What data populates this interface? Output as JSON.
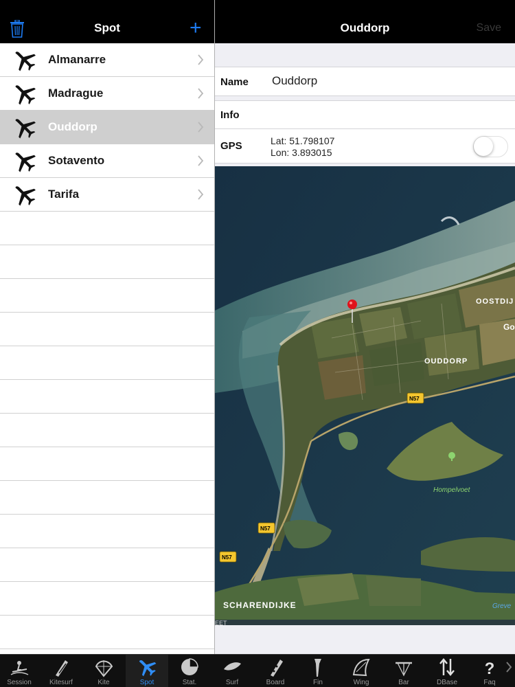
{
  "left_panel": {
    "title": "Spot",
    "spots": [
      {
        "label": "Almanarre",
        "selected": false
      },
      {
        "label": "Madrague",
        "selected": false
      },
      {
        "label": "Ouddorp",
        "selected": true
      },
      {
        "label": "Sotavento",
        "selected": false
      },
      {
        "label": "Tarifa",
        "selected": false
      }
    ]
  },
  "detail": {
    "title": "Ouddorp",
    "save_label": "Save",
    "name_label": "Name",
    "name_value": "Ouddorp",
    "info_label": "Info",
    "gps_label": "GPS",
    "lat": "Lat: 51.798107",
    "lon": "Lon: 3.893015",
    "gps_toggle_on": false
  },
  "map": {
    "labels": {
      "oostdijk": "OOSTDIJ",
      "go": "Go",
      "ouddorp": "OUDDORP",
      "road1": "N57",
      "road2": "N57",
      "road3": "N57",
      "hompelvoet": "Hompelvoet",
      "scharendijke": "SCHARENDIJKE",
      "greve": "Greve",
      "feet": "EET"
    }
  },
  "tabs": [
    {
      "label": "Session",
      "icon": "kitesurfer-icon",
      "active": false
    },
    {
      "label": "Kitesurf",
      "icon": "kitesurf-board-icon",
      "active": false
    },
    {
      "label": "Kite",
      "icon": "kite-icon",
      "active": false
    },
    {
      "label": "Spot",
      "icon": "airplane-icon",
      "active": true
    },
    {
      "label": "Stat.",
      "icon": "pie-chart-icon",
      "active": false
    },
    {
      "label": "Surf",
      "icon": "surfboard-icon",
      "active": false
    },
    {
      "label": "Board",
      "icon": "board-icon",
      "active": false
    },
    {
      "label": "Fin",
      "icon": "fin-icon",
      "active": false
    },
    {
      "label": "Wing",
      "icon": "wing-icon",
      "active": false
    },
    {
      "label": "Bar",
      "icon": "control-bar-icon",
      "active": false
    },
    {
      "label": "DBase",
      "icon": "sync-arrows-icon",
      "active": false
    },
    {
      "label": "Faq",
      "icon": "question-icon",
      "active": false
    }
  ],
  "colors": {
    "accent": "#1d7bf2",
    "selected_row": "#cfcfcf",
    "active_tab_label": "#2f8df5"
  }
}
